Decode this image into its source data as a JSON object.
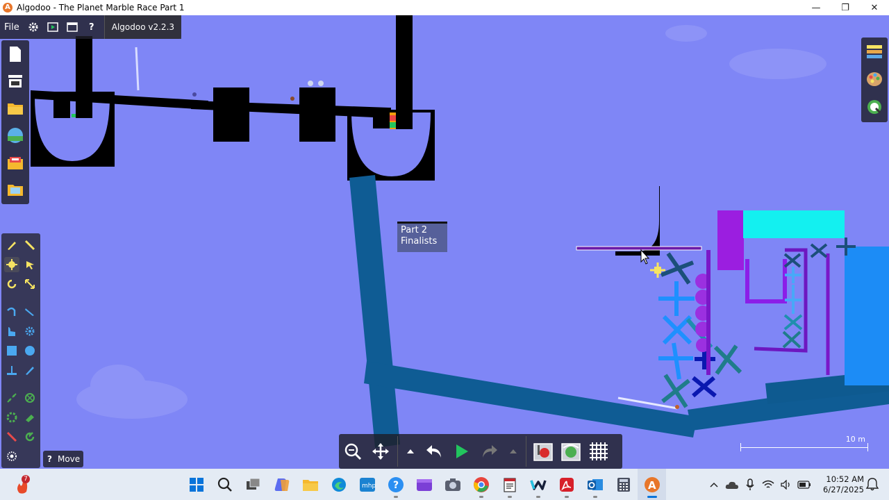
{
  "window": {
    "title": "Algodoo - The Planet Marble Race Part 1",
    "app_icon": "algodoo-icon",
    "controls": {
      "minimize": "—",
      "maximize": "❐",
      "close": "✕"
    }
  },
  "toolbar": {
    "file_label": "File",
    "settings_icon": "gear-icon",
    "play_scene_icon": "scene-icon",
    "window_icon": "window-icon",
    "help_label": "?",
    "version": "Algodoo v2.2.3"
  },
  "left_panel": {
    "items": [
      "new-scene-icon",
      "scene-list-icon",
      "open-folder-icon",
      "algobox-icon",
      "toolbox-icon",
      "browse-folder-icon"
    ]
  },
  "tools": {
    "items": [
      "sketch-tool",
      "cut-tool",
      "move-tool",
      "drag-tool",
      "rotate-tool",
      "scale-tool",
      "rope-tool",
      "knife-tool",
      "brush-tool",
      "gear-tool",
      "box-tool",
      "circle-tool",
      "plane-tool",
      "pencil-tool",
      "chain-tool",
      "hinge-tool",
      "axle-tool",
      "tracer-tool",
      "laser-tool",
      "thruster-tool",
      "spring-tool"
    ],
    "status": {
      "help": "?",
      "current_tool": "Move"
    }
  },
  "right_panel": {
    "items": [
      "materials-icon",
      "appearance-icon",
      "information-icon"
    ]
  },
  "bottom_toolbar": {
    "items": [
      "zoom-icon",
      "pan-icon",
      "undo-menu-icon",
      "undo-icon",
      "play-icon",
      "redo-icon",
      "redo-menu-icon",
      "gravity-icon",
      "air-friction-icon",
      "grid-icon"
    ],
    "play_color": "#22c55e"
  },
  "scene": {
    "annotation_line1": "Part 2",
    "annotation_line2": "Finalists",
    "scale_label": "10 m",
    "background_color": "#7f86f6"
  },
  "taskbar": {
    "notification_badge": "7",
    "apps": [
      "start-icon",
      "search-icon",
      "task-view-icon",
      "copilot-icon",
      "file-explorer-icon",
      "edge-icon",
      "mhp-icon",
      "help-icon",
      "clipchamp-icon",
      "camera-icon",
      "chrome-icon",
      "notepad-icon",
      "webex-icon",
      "acrobat-icon",
      "outlook-icon",
      "calculator-icon",
      "algodoo-taskbar-icon"
    ],
    "clock_time": "10:52 AM",
    "clock_date": "6/27/2025"
  }
}
